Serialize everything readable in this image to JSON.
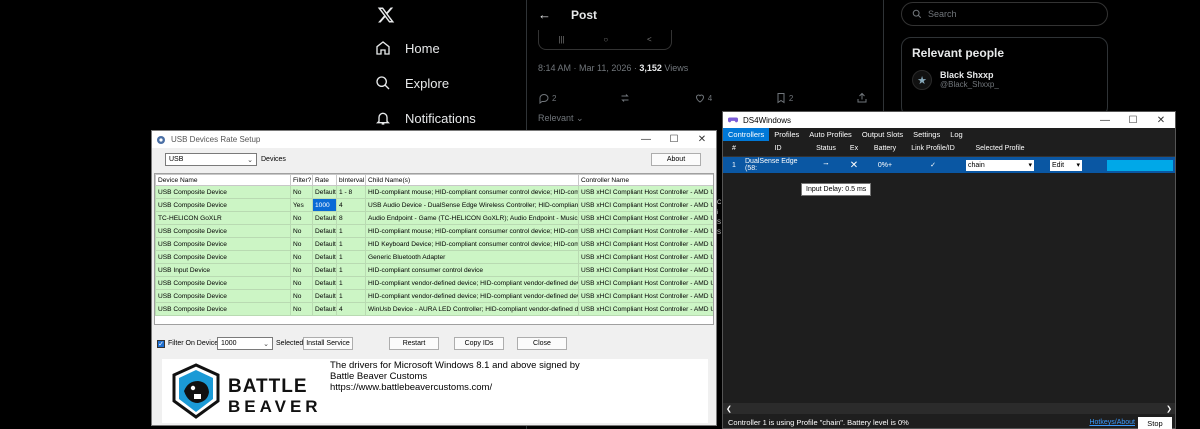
{
  "x": {
    "nav": [
      {
        "label": "Home",
        "icon": "home-icon"
      },
      {
        "label": "Explore",
        "icon": "search-icon"
      },
      {
        "label": "Notifications",
        "icon": "bell-icon"
      }
    ],
    "post": {
      "title": "Post",
      "meta_prefix": "8:14 AM · Mar 11, 2026 · ",
      "views_count": "3,152",
      "views_label": " Views",
      "replies": "2",
      "likes": "4",
      "bookmarks": "2",
      "sort_label": "Relevant"
    },
    "search_placeholder": "Search",
    "relevant": {
      "heading": "Relevant people",
      "name": "Black Shxxp",
      "handle": "@Black_Shxxp_"
    }
  },
  "usb": {
    "title": "USB Devices Rate Setup",
    "filter_value": "USB",
    "devices_label": "Devices",
    "about_label": "About",
    "columns": [
      "Device Name",
      "Filter?",
      "Rate",
      "bInterval",
      "Child Name(s)",
      "Controller Name"
    ],
    "rows": [
      [
        "USB Composite Device",
        "No",
        "Default",
        "1 - 8",
        "HID-compliant mouse; HID-compliant consumer control device; HID-complia",
        "USB xHCI Compliant Host Controller - AMD U"
      ],
      [
        "USB Composite Device",
        "Yes",
        "1000",
        "4",
        "USB Audio Device - DualSense Edge Wireless Controller; HID-compliant gar",
        "USB xHCI Compliant Host Controller - AMD U"
      ],
      [
        "TC-HELICON GoXLR",
        "No",
        "Default",
        "8",
        "Audio Endpoint - Game (TC-HELICON GoXLR); Audio Endpoint - Music (TC-",
        "USB xHCI Compliant Host Controller - AMD U"
      ],
      [
        "USB Composite Device",
        "No",
        "Default",
        "1",
        "HID-compliant mouse; HID-compliant consumer control device; HID-complia",
        "USB xHCI Compliant Host Controller - AMD U"
      ],
      [
        "USB Composite Device",
        "No",
        "Default",
        "1",
        "HID Keyboard Device; HID-compliant consumer control device; HID-complia",
        "USB xHCI Compliant Host Controller - AMD U"
      ],
      [
        "USB Composite Device",
        "No",
        "Default",
        "1",
        "Generic Bluetooth Adapter",
        "USB xHCI Compliant Host Controller - AMD U"
      ],
      [
        "USB Input Device",
        "No",
        "Default",
        "1",
        "HID-compliant consumer control device",
        "USB xHCI Compliant Host Controller - AMD U"
      ],
      [
        "USB Composite Device",
        "No",
        "Default",
        "1",
        "HID-compliant vendor-defined device; HID-compliant vendor-defined device",
        "USB xHCI Compliant Host Controller - AMD U"
      ],
      [
        "USB Composite Device",
        "No",
        "Default",
        "1",
        "HID-compliant vendor-defined device; HID-compliant vendor-defined device",
        "USB xHCI Compliant Host Controller - AMD U"
      ],
      [
        "USB Composite Device",
        "No",
        "Default",
        "4",
        "WinUsb Device - AURA LED Controller; HID-compliant vendor-defined device",
        "USB xHCI Compliant Host Controller - AMD U"
      ]
    ],
    "filter_on_device_label": "Filter On Device",
    "rate_value": "1000",
    "selected_rate_label": "Selected Rate",
    "install_label": "Install Service",
    "restart_label": "Restart",
    "copy_label": "Copy IDs",
    "close_label": "Close",
    "promo_line1": "The drivers for Microsoft Windows 8.1 and above signed by",
    "promo_line2": "Battle Beaver Customs",
    "promo_url": "https://www.battlebeavercustoms.com/",
    "logo_word1": "BATTLE",
    "logo_word2": "BEAVER"
  },
  "ds4": {
    "title": "DS4Windows",
    "tabs": [
      "Controllers",
      "Profiles",
      "Auto Profiles",
      "Output Slots",
      "Settings",
      "Log"
    ],
    "columns": [
      "#",
      "ID",
      "Status",
      "Ex",
      "Battery",
      "Link Profile/ID",
      "Selected Profile"
    ],
    "row": {
      "num": "1",
      "id": "DualSense Edge (58:",
      "battery": "0%+",
      "profile": "chain",
      "edit": "Edit"
    },
    "tooltip": "Input Delay: 0.5 ms",
    "status_text": "Controller 1 is using Profile \"chain\". Battery level is 0%",
    "hotkeys_label": "Hotkeys/About",
    "stop_label": "Stop"
  },
  "colors": {
    "row_green": "#ccf5c5",
    "selection_blue": "#0a6bd6",
    "ds4_tab_active": "#0078d7",
    "ds4_bar": "#00a8e8"
  }
}
